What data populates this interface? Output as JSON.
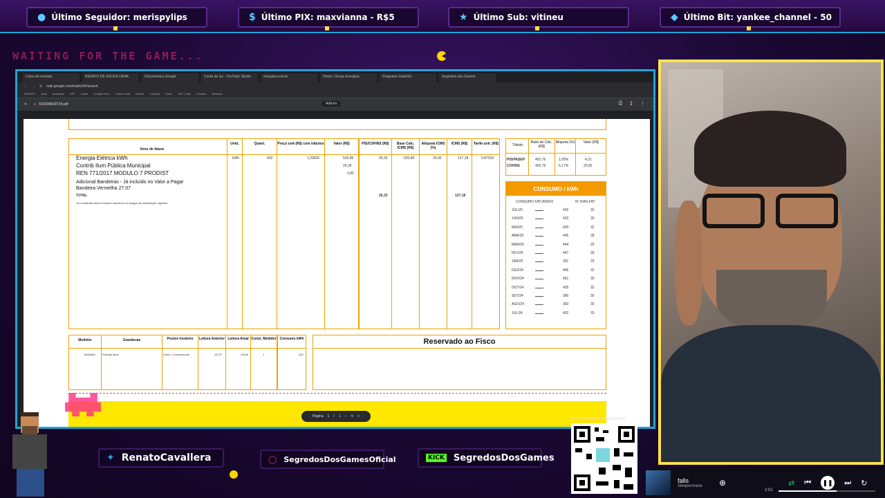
{
  "alerts": [
    {
      "icon": "user-icon",
      "text": "Último Seguidor: merispylips"
    },
    {
      "icon": "dollar-icon",
      "text": "Último PIX: maxvianna - R$5"
    },
    {
      "icon": "star-icon",
      "text": "Último Sub: vitineu"
    },
    {
      "icon": "diamond-icon",
      "text": "Último Bit: yankee_channel - 50"
    }
  ],
  "overlay": {
    "waiting_text": "WAITING FOR THE GAME..."
  },
  "browser": {
    "tabs": [
      "Caixa de entrada",
      "RENATO DE SOUZA CAVAL",
      "Documentos Google",
      "Conta de luz - YouTube Studio",
      "energisa.com.br",
      "Home / Grupo Energisa",
      "Programa SolaiClic",
      "Segredos dos Games"
    ],
    "url": "mail.google.com/mail/u/0/#search",
    "bookmarks": [
      "RENATO",
      "Nota",
      "Incalcular",
      "SEF",
      "Gmail",
      "Google Drive",
      "Cobrar Nota",
      "Marvel",
      "Coleção",
      "Fatos",
      "SEO Tools",
      "Cookies",
      "Mercado"
    ],
    "pdf_filename": "5SS5N8O9T34.pdf",
    "zoom": "Add-on"
  },
  "invoice": {
    "table_headers": [
      "Itens de fatura",
      "Unid.",
      "Quant.",
      "Preço unit (R$) com tributos",
      "Valor (R$)",
      "PIS/COFINS (R$)",
      "Base Calc. ICMS (R$)",
      "Alíquota ICMS (%)",
      "ICMS (R$)",
      "Tarifa unit. (R$)"
    ],
    "items": [
      "Energia Elétrica kWh",
      "Contrib Ilum Pública Municipal",
      "REN 771/2017 MODULO 7 PRODIST",
      "Adicional Bandeiras - Já incluído no Valor a Pagar",
      "Bandeira Vermelha 27.07"
    ],
    "total_label": "TOTAL",
    "row1": {
      "unit": "kWh",
      "qty": "432",
      "price": "1,20626",
      "value": "520,85",
      "pis_cofins": "25,33",
      "base_icms": "520,85",
      "aliq": "24,00",
      "icms": "127,18",
      "tarifa": "0,87018"
    },
    "row2": {
      "value": "26,36"
    },
    "row3": {
      "value": "0,85"
    },
    "totals": {
      "pis_cofins": "25,33",
      "icms": "127,18"
    },
    "footnote": "Os montantes acima incluem impostos e encargos de distribuição vigentes",
    "tributos": {
      "headers": [
        "Tributo",
        "Base de Cálc. (R$)",
        "Alíquota (%)",
        "Valor (R$)"
      ],
      "rows": [
        {
          "name": "PIS/PASEP",
          "base": "402,76",
          "aliq": "1,05%",
          "valor": "4,21"
        },
        {
          "name": "COFINS",
          "base": "402,76",
          "aliq": "5,17%",
          "valor": "20,82"
        }
      ]
    },
    "consumo": {
      "title": "CONSUMO / kWh",
      "col_left": "CONSUMO FATURADO",
      "col_right": "Nº DIAS FAT",
      "rows": [
        {
          "month": "JUL/25",
          "kwh": "432",
          "days": "33"
        },
        {
          "month": "JUN/25",
          "kwh": "433",
          "days": "30"
        },
        {
          "month": "MAI/25",
          "kwh": "430",
          "days": "32"
        },
        {
          "month": "ABR/25",
          "kwh": "445",
          "days": "28"
        },
        {
          "month": "MAR/25",
          "kwh": "444",
          "days": "29"
        },
        {
          "month": "FEV/25",
          "kwh": "447",
          "days": "30"
        },
        {
          "month": "JAN/25",
          "kwh": "391",
          "days": "29"
        },
        {
          "month": "DEZ/24",
          "kwh": "456",
          "days": "32"
        },
        {
          "month": "NOV/24",
          "kwh": "461",
          "days": "30"
        },
        {
          "month": "OUT/24",
          "kwh": "435",
          "days": "32"
        },
        {
          "month": "SET/24",
          "kwh": "390",
          "days": "30"
        },
        {
          "month": "AGO/24",
          "kwh": "393",
          "days": "30"
        },
        {
          "month": "JUL/24",
          "kwh": "452",
          "days": "33"
        }
      ]
    },
    "medidor": {
      "headers": [
        "Medidor",
        "Grandezas",
        "Postos horários",
        "Leitura Anterior",
        "Leitura Atual",
        "Const. Medidor",
        "Consumo kWh"
      ],
      "row": {
        "medidor": "8484848",
        "grandeza": "Energia ativa",
        "posto": "Único / Convencional",
        "anterior": "14737",
        "atual": "15169",
        "const": "1",
        "consumo": "432"
      }
    },
    "fisco_title": "Reservado ao Fisco"
  },
  "pdf_page": {
    "label": "Página",
    "current": "1",
    "sep": "/",
    "total": "1"
  },
  "social": {
    "twitter": "RenatoCavallera",
    "instagram": "SegredosDosGamesOficial",
    "kick_badge": "KICK",
    "kick": "SegredosDosGames"
  },
  "qr_label": "livepix.gg/segredosdosgames",
  "player": {
    "track": "falls",
    "artist": "Sleepermane",
    "time": "2:01"
  },
  "colors": {
    "accent_cyan": "#1ea6d8",
    "invoice_orange": "#f0a000",
    "cam_border": "#ffe34a",
    "kick_green": "#53fc18"
  }
}
